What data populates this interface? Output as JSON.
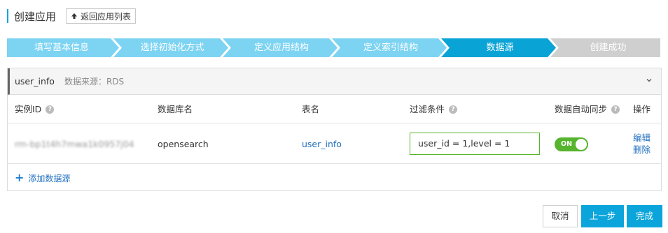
{
  "header": {
    "title": "创建应用",
    "back_label": "返回应用列表"
  },
  "steps": [
    {
      "label": "填写基本信息",
      "state": "done"
    },
    {
      "label": "选择初始化方式",
      "state": "done"
    },
    {
      "label": "定义应用结构",
      "state": "done"
    },
    {
      "label": "定义索引结构",
      "state": "done"
    },
    {
      "label": "数据源",
      "state": "active"
    },
    {
      "label": "创建成功",
      "state": "pending"
    }
  ],
  "colors": {
    "step_done": "#7dd3f2",
    "step_active": "#0aa3d6",
    "step_pending": "#cfcfcf",
    "link": "#1f6fbf",
    "toggle_on": "#56b42e",
    "primary": "#0ba5db"
  },
  "panel": {
    "name": "user_info",
    "source_label": "数据来源：RDS",
    "columns": {
      "instance_id": "实例ID",
      "database": "数据库名",
      "table": "表名",
      "filter": "过滤条件",
      "auto_sync": "数据自动同步",
      "actions": "操作"
    },
    "row": {
      "instance_id": "rm-bp1t4h7mwa1k0957j04",
      "database": "opensearch",
      "table": "user_info",
      "filter": "user_id = 1,level = 1",
      "toggle_label": "ON",
      "edit": "编辑",
      "delete": "删除"
    },
    "add_label": "添加数据源"
  },
  "footer": {
    "cancel": "取消",
    "prev": "上一步",
    "finish": "完成"
  }
}
